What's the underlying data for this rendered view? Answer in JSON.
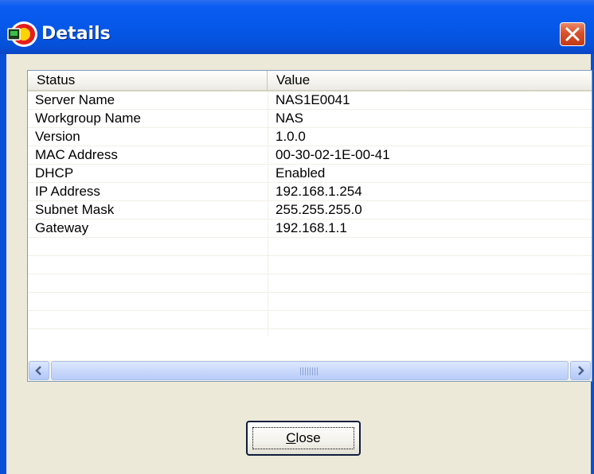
{
  "window": {
    "title": "Details",
    "icon": "app-icon",
    "close_icon": "close-x-icon"
  },
  "list": {
    "columns": [
      "Status",
      "Value"
    ],
    "rows": [
      {
        "key": "Server Name",
        "value": "NAS1E0041"
      },
      {
        "key": "Workgroup Name",
        "value": "NAS"
      },
      {
        "key": "Version",
        "value": "1.0.0"
      },
      {
        "key": "MAC Address",
        "value": "00-30-02-1E-00-41"
      },
      {
        "key": "DHCP",
        "value": "Enabled"
      },
      {
        "key": "IP Address",
        "value": "192.168.1.254"
      },
      {
        "key": "Subnet Mask",
        "value": "255.255.255.0"
      },
      {
        "key": "Gateway",
        "value": "192.168.1.1"
      }
    ],
    "empty_rows": 5,
    "scrollbar": {
      "left_icon": "arrow-left-icon",
      "right_icon": "arrow-right-icon",
      "grip_icon": "grip-icon"
    }
  },
  "buttons": {
    "close_accel": "C",
    "close_rest": "lose"
  },
  "colors": {
    "titlebar": "#0557e8",
    "dialog_bg": "#ece9d8",
    "close_red": "#d8502c"
  }
}
